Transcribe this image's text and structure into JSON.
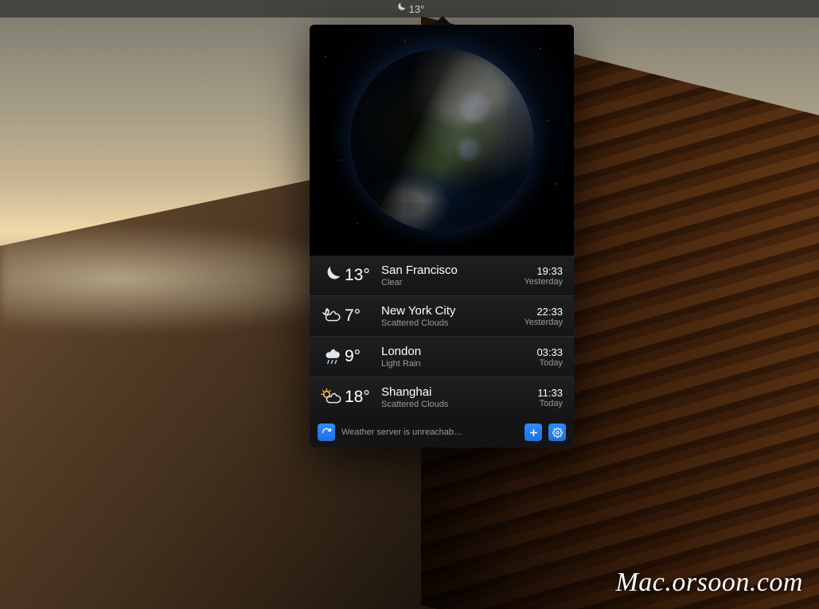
{
  "menubar": {
    "icon": "moon-icon",
    "temp": "13°"
  },
  "cities": [
    {
      "icon": "moon",
      "temp": "13°",
      "name": "San Francisco",
      "cond": "Clear",
      "clock": "19:33",
      "day": "Yesterday"
    },
    {
      "icon": "night-cloud",
      "temp": "7°",
      "name": "New York City",
      "cond": "Scattered Clouds",
      "clock": "22:33",
      "day": "Yesterday"
    },
    {
      "icon": "rain-cloud",
      "temp": "9°",
      "name": "London",
      "cond": "Light Rain",
      "clock": "03:33",
      "day": "Today"
    },
    {
      "icon": "sun-cloud",
      "temp": "18°",
      "name": "Shanghai",
      "cond": "Scattered Clouds",
      "clock": "11:33",
      "day": "Today"
    }
  ],
  "footer": {
    "status": "Weather server is unreachab…"
  },
  "watermark": "Mac.orsoon.com"
}
